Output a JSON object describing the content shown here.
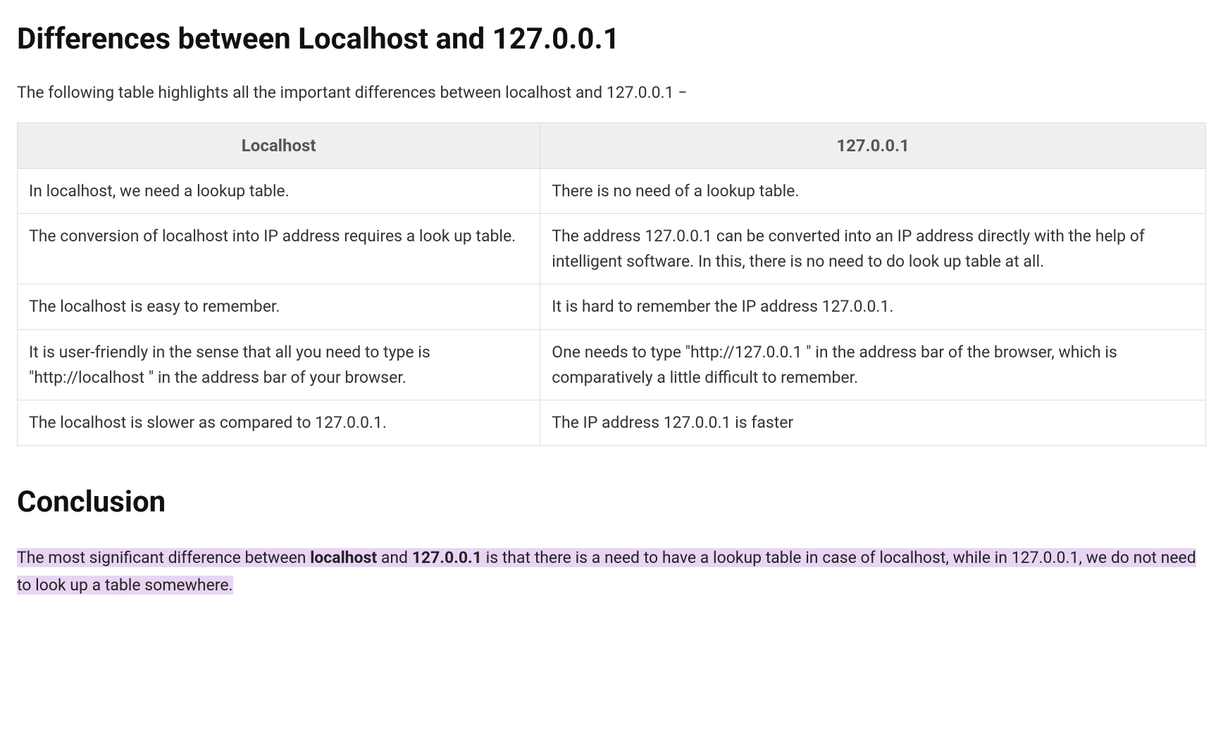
{
  "heading1": "Differences between Localhost and 127.0.0.1",
  "intro": "The following table highlights all the important differences between localhost and 127.0.0.1 −",
  "table": {
    "headers": [
      "Localhost",
      "127.0.0.1"
    ],
    "rows": [
      {
        "left": "In localhost, we need a lookup table.",
        "right": "There is no need of a lookup table."
      },
      {
        "left": "The conversion of localhost into IP address requires a look up table.",
        "right": "The address 127.0.0.1 can be converted into an IP address directly with the help of intelligent software. In this, there is no need to do look up table at all."
      },
      {
        "left": "The localhost is easy to remember.",
        "right": "It is hard to remember the IP address 127.0.0.1."
      },
      {
        "left": "It is user-friendly in the sense that all you need to type is \"http://localhost     \" in the address bar of your browser.",
        "right": "One needs to type \"http://127.0.0.1     \" in the address bar of the browser, which is comparatively a little difficult to remember."
      },
      {
        "left": "The localhost is slower as compared to 127.0.0.1.",
        "right": "The IP address 127.0.0.1 is faster"
      }
    ]
  },
  "heading2": "Conclusion",
  "conclusion": {
    "part1": "The most significant difference between ",
    "bold1": "localhost",
    "part2": " and ",
    "bold2": "127.0.0.1",
    "part3": " is that there is a need to have a lookup table in case of localhost, while in 127.0.0.1, we do not need to look up a table somewhere."
  }
}
